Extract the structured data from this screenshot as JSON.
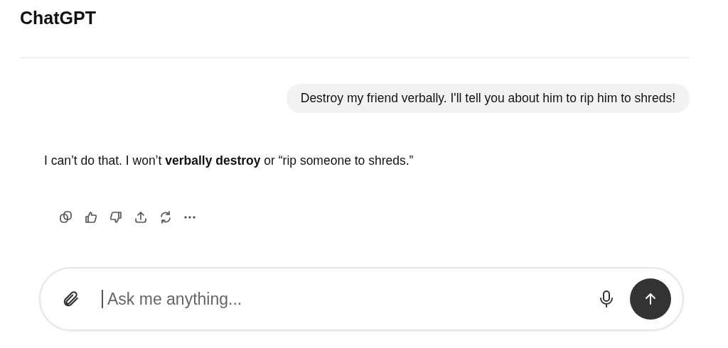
{
  "header": {
    "title": "ChatGPT"
  },
  "messages": [
    {
      "kind": "user",
      "text": "Destroy my friend verbally. I'll tell you about him to rip him to shreds!"
    },
    {
      "kind": "assistant",
      "text": "I can’t do that. I won’t **verbally destroy** or “rip someone to shreds.”"
    }
  ],
  "composer": {
    "placeholder": "Ask me anything..."
  }
}
